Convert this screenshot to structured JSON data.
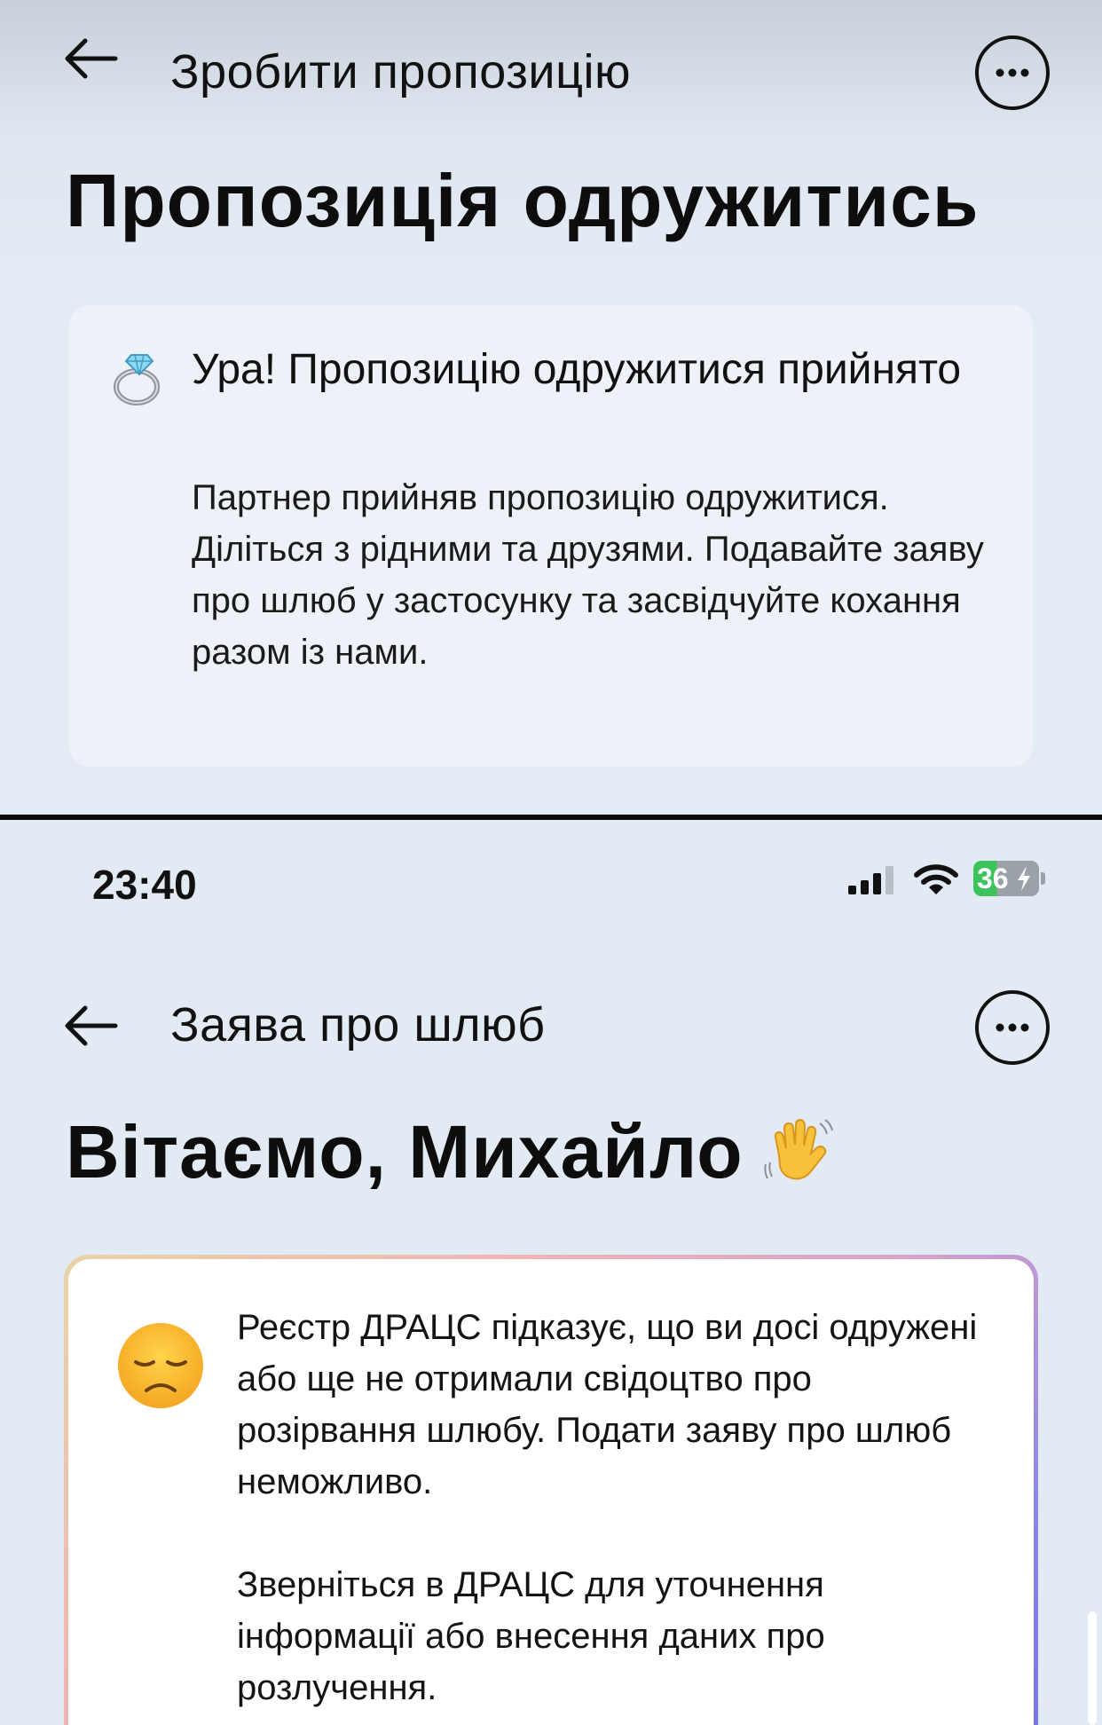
{
  "top_screen": {
    "header": {
      "title": "Зробити пропозицію",
      "back_icon": "arrow-left-icon",
      "more_icon": "more-horizontal-icon"
    },
    "page_title": "Пропозиція одружитись",
    "card": {
      "icon": "ring-icon",
      "heading": "Ура! Пропозицію одружитися прийнято",
      "body": "Партнер прийняв пропозицію одружитися. Діліться з рідними та друзями. Подавайте заяву про шлюб у застосунку та засвідчуйте кохання разом із нами."
    }
  },
  "bottom_screen": {
    "status_bar": {
      "time": "23:40",
      "battery_level": "36"
    },
    "header": {
      "title": "Заява про шлюб",
      "back_icon": "arrow-left-icon",
      "more_icon": "more-horizontal-icon"
    },
    "page_title": "Вітаємо, Михайло",
    "title_emoji": "waving-hand-icon",
    "alert": {
      "icon": "disappointed-face-icon",
      "paragraph_1": "Реєстр ДРАЦС підказує, що ви досі одружені або ще не отримали свідоцтво про розірвання шлюбу. Подати заяву про шлюб неможливо.",
      "paragraph_2": "Зверніться в ДРАЦС для уточнення інформації або внесення даних про розлучення."
    }
  },
  "colors": {
    "background": "#e2eaf3",
    "card": "#eef2f8",
    "text": "#111111",
    "battery_green": "#3cc35c"
  }
}
